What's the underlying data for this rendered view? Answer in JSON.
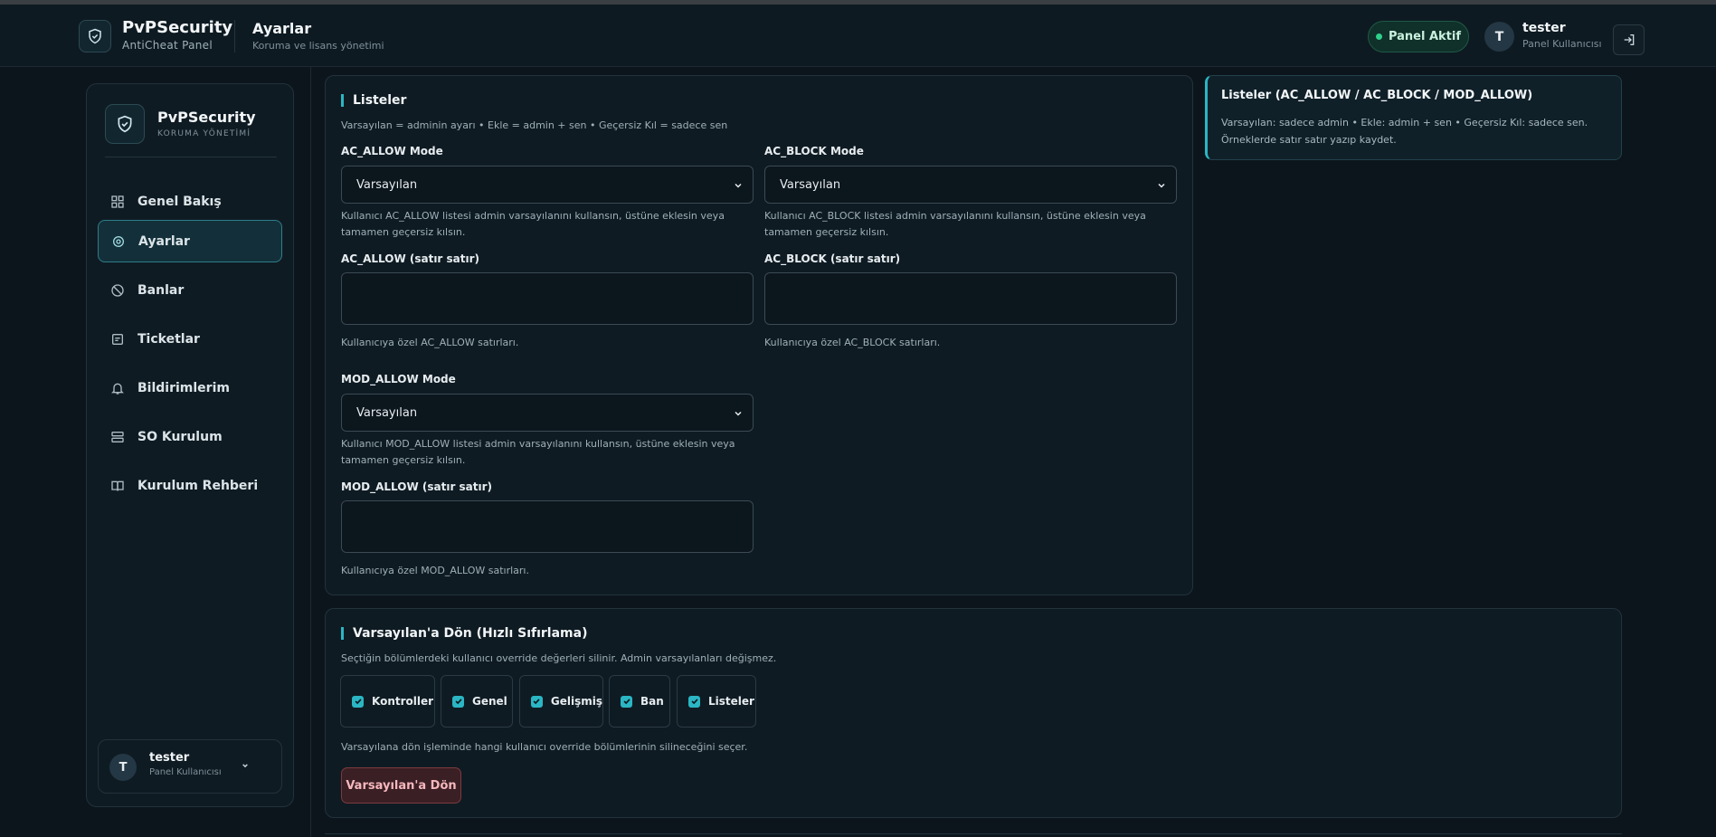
{
  "header": {
    "brand_name": "PvPSecurity",
    "brand_sub": "AntiCheat Panel",
    "page_title": "Ayarlar",
    "page_subtitle": "Koruma ve lisans yönetimi",
    "status": "Panel Aktif",
    "avatar_initial": "T",
    "user_name": "tester",
    "user_role": "Panel Kullanıcısı"
  },
  "sidebar": {
    "brand_name": "PvPSecurity",
    "brand_sub": "KORUMA YÖNETİMİ",
    "items": [
      {
        "label": "Genel Bakış",
        "icon": "grid-icon"
      },
      {
        "label": "Ayarlar",
        "icon": "gear-icon",
        "active": true
      },
      {
        "label": "Banlar",
        "icon": "ban-icon"
      },
      {
        "label": "Ticketlar",
        "icon": "ticket-icon"
      },
      {
        "label": "Bildirimlerim",
        "icon": "bell-icon"
      },
      {
        "label": "SO Kurulum",
        "icon": "server-icon"
      },
      {
        "label": "Kurulum Rehberi",
        "icon": "book-icon"
      }
    ],
    "user": {
      "initial": "T",
      "name": "tester",
      "role": "Panel Kullanıcısı"
    }
  },
  "lists": {
    "title": "Listeler",
    "subtitle": "Varsayılan = adminin ayarı • Ekle = admin + sen • Geçersiz Kıl = sadece sen",
    "ac_allow": {
      "mode_label": "AC_ALLOW Mode",
      "mode_value": "Varsayılan",
      "mode_help": "Kullanıcı AC_ALLOW listesi admin varsayılanını kullansın, üstüne eklesin veya tamamen geçersiz kılsın.",
      "lines_label": "AC_ALLOW (satır satır)",
      "lines_value": "",
      "lines_help": "Kullanıcıya özel AC_ALLOW satırları."
    },
    "ac_block": {
      "mode_label": "AC_BLOCK Mode",
      "mode_value": "Varsayılan",
      "mode_help": "Kullanıcı AC_BLOCK listesi admin varsayılanını kullansın, üstüne eklesin veya tamamen geçersiz kılsın.",
      "lines_label": "AC_BLOCK (satır satır)",
      "lines_value": "",
      "lines_help": "Kullanıcıya özel AC_BLOCK satırları."
    },
    "mod_allow": {
      "mode_label": "MOD_ALLOW Mode",
      "mode_value": "Varsayılan",
      "mode_help": "Kullanıcı MOD_ALLOW listesi admin varsayılanını kullansın, üstüne eklesin veya tamamen geçersiz kılsın.",
      "lines_label": "MOD_ALLOW (satır satır)",
      "lines_value": "",
      "lines_help": "Kullanıcıya özel MOD_ALLOW satırları."
    }
  },
  "info": {
    "title": "Listeler (AC_ALLOW / AC_BLOCK / MOD_ALLOW)",
    "text": "Varsayılan: sadece admin • Ekle: admin + sen • Geçersiz Kıl: sadece sen. Örneklerde satır satır yazıp kaydet."
  },
  "reset": {
    "title": "Varsayılan'a Dön (Hızlı Sıfırlama)",
    "subtitle": "Seçtiğin bölümlerdeki kullanıcı override değerleri silinir. Admin varsayılanları değişmez.",
    "options": [
      {
        "label": "Kontroller",
        "checked": true
      },
      {
        "label": "Genel",
        "checked": true
      },
      {
        "label": "Gelişmiş",
        "checked": true
      },
      {
        "label": "Ban",
        "checked": true
      },
      {
        "label": "Listeler",
        "checked": true
      }
    ],
    "help": "Varsayılana dön işleminde hangi kullanıcı override bölümlerinin silineceğini seçer.",
    "button": "Varsayılan'a Dön"
  },
  "colors": {
    "accent": "#2bb6c4",
    "status_green": "#2fd089",
    "danger": "#f5b8bd",
    "background": "#0c151c"
  }
}
